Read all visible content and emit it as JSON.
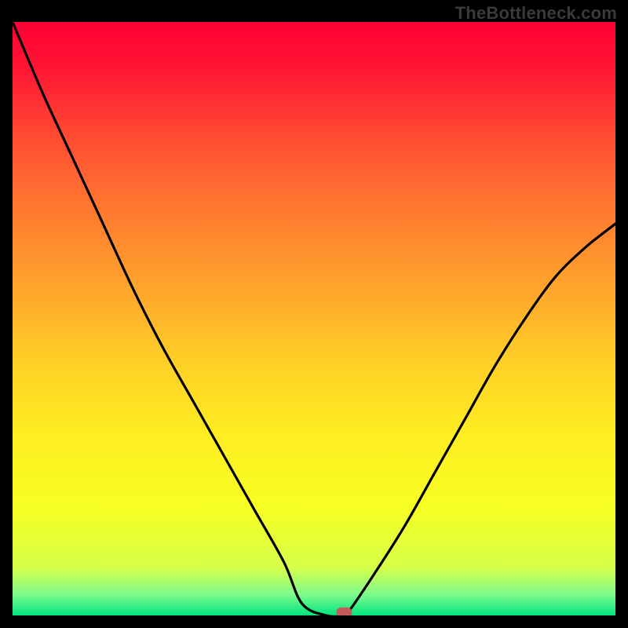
{
  "watermark": "TheBottleneck.com",
  "chart_data": {
    "type": "line",
    "title": "",
    "xlabel": "",
    "ylabel": "",
    "xlim": [
      0,
      100
    ],
    "ylim": [
      0,
      100
    ],
    "x": [
      0,
      5,
      10,
      15,
      20,
      25,
      30,
      35,
      40,
      45,
      48,
      52,
      55,
      56,
      60,
      65,
      70,
      75,
      80,
      85,
      90,
      95,
      100
    ],
    "values": [
      100,
      88,
      77,
      66,
      55,
      45,
      36,
      27,
      18,
      9,
      2,
      0,
      0,
      1,
      7,
      15,
      24,
      33,
      42,
      50,
      57,
      62,
      66
    ],
    "marker_point": {
      "x": 55,
      "y": 0.5
    },
    "background_gradient": {
      "stops": [
        {
          "pos": 0.0,
          "color": "#ff0035"
        },
        {
          "pos": 0.08,
          "color": "#ff1634"
        },
        {
          "pos": 0.2,
          "color": "#ff4e32"
        },
        {
          "pos": 0.32,
          "color": "#ff7a30"
        },
        {
          "pos": 0.45,
          "color": "#ffa52c"
        },
        {
          "pos": 0.58,
          "color": "#ffd226"
        },
        {
          "pos": 0.7,
          "color": "#ffee20"
        },
        {
          "pos": 0.82,
          "color": "#f7ff24"
        },
        {
          "pos": 0.92,
          "color": "#d6ff4a"
        },
        {
          "pos": 0.965,
          "color": "#7dfb8e"
        },
        {
          "pos": 1.0,
          "color": "#00e57e"
        }
      ]
    },
    "marker_color": "#c45a5a",
    "line_color": "#000000",
    "line_width": 3.2
  }
}
